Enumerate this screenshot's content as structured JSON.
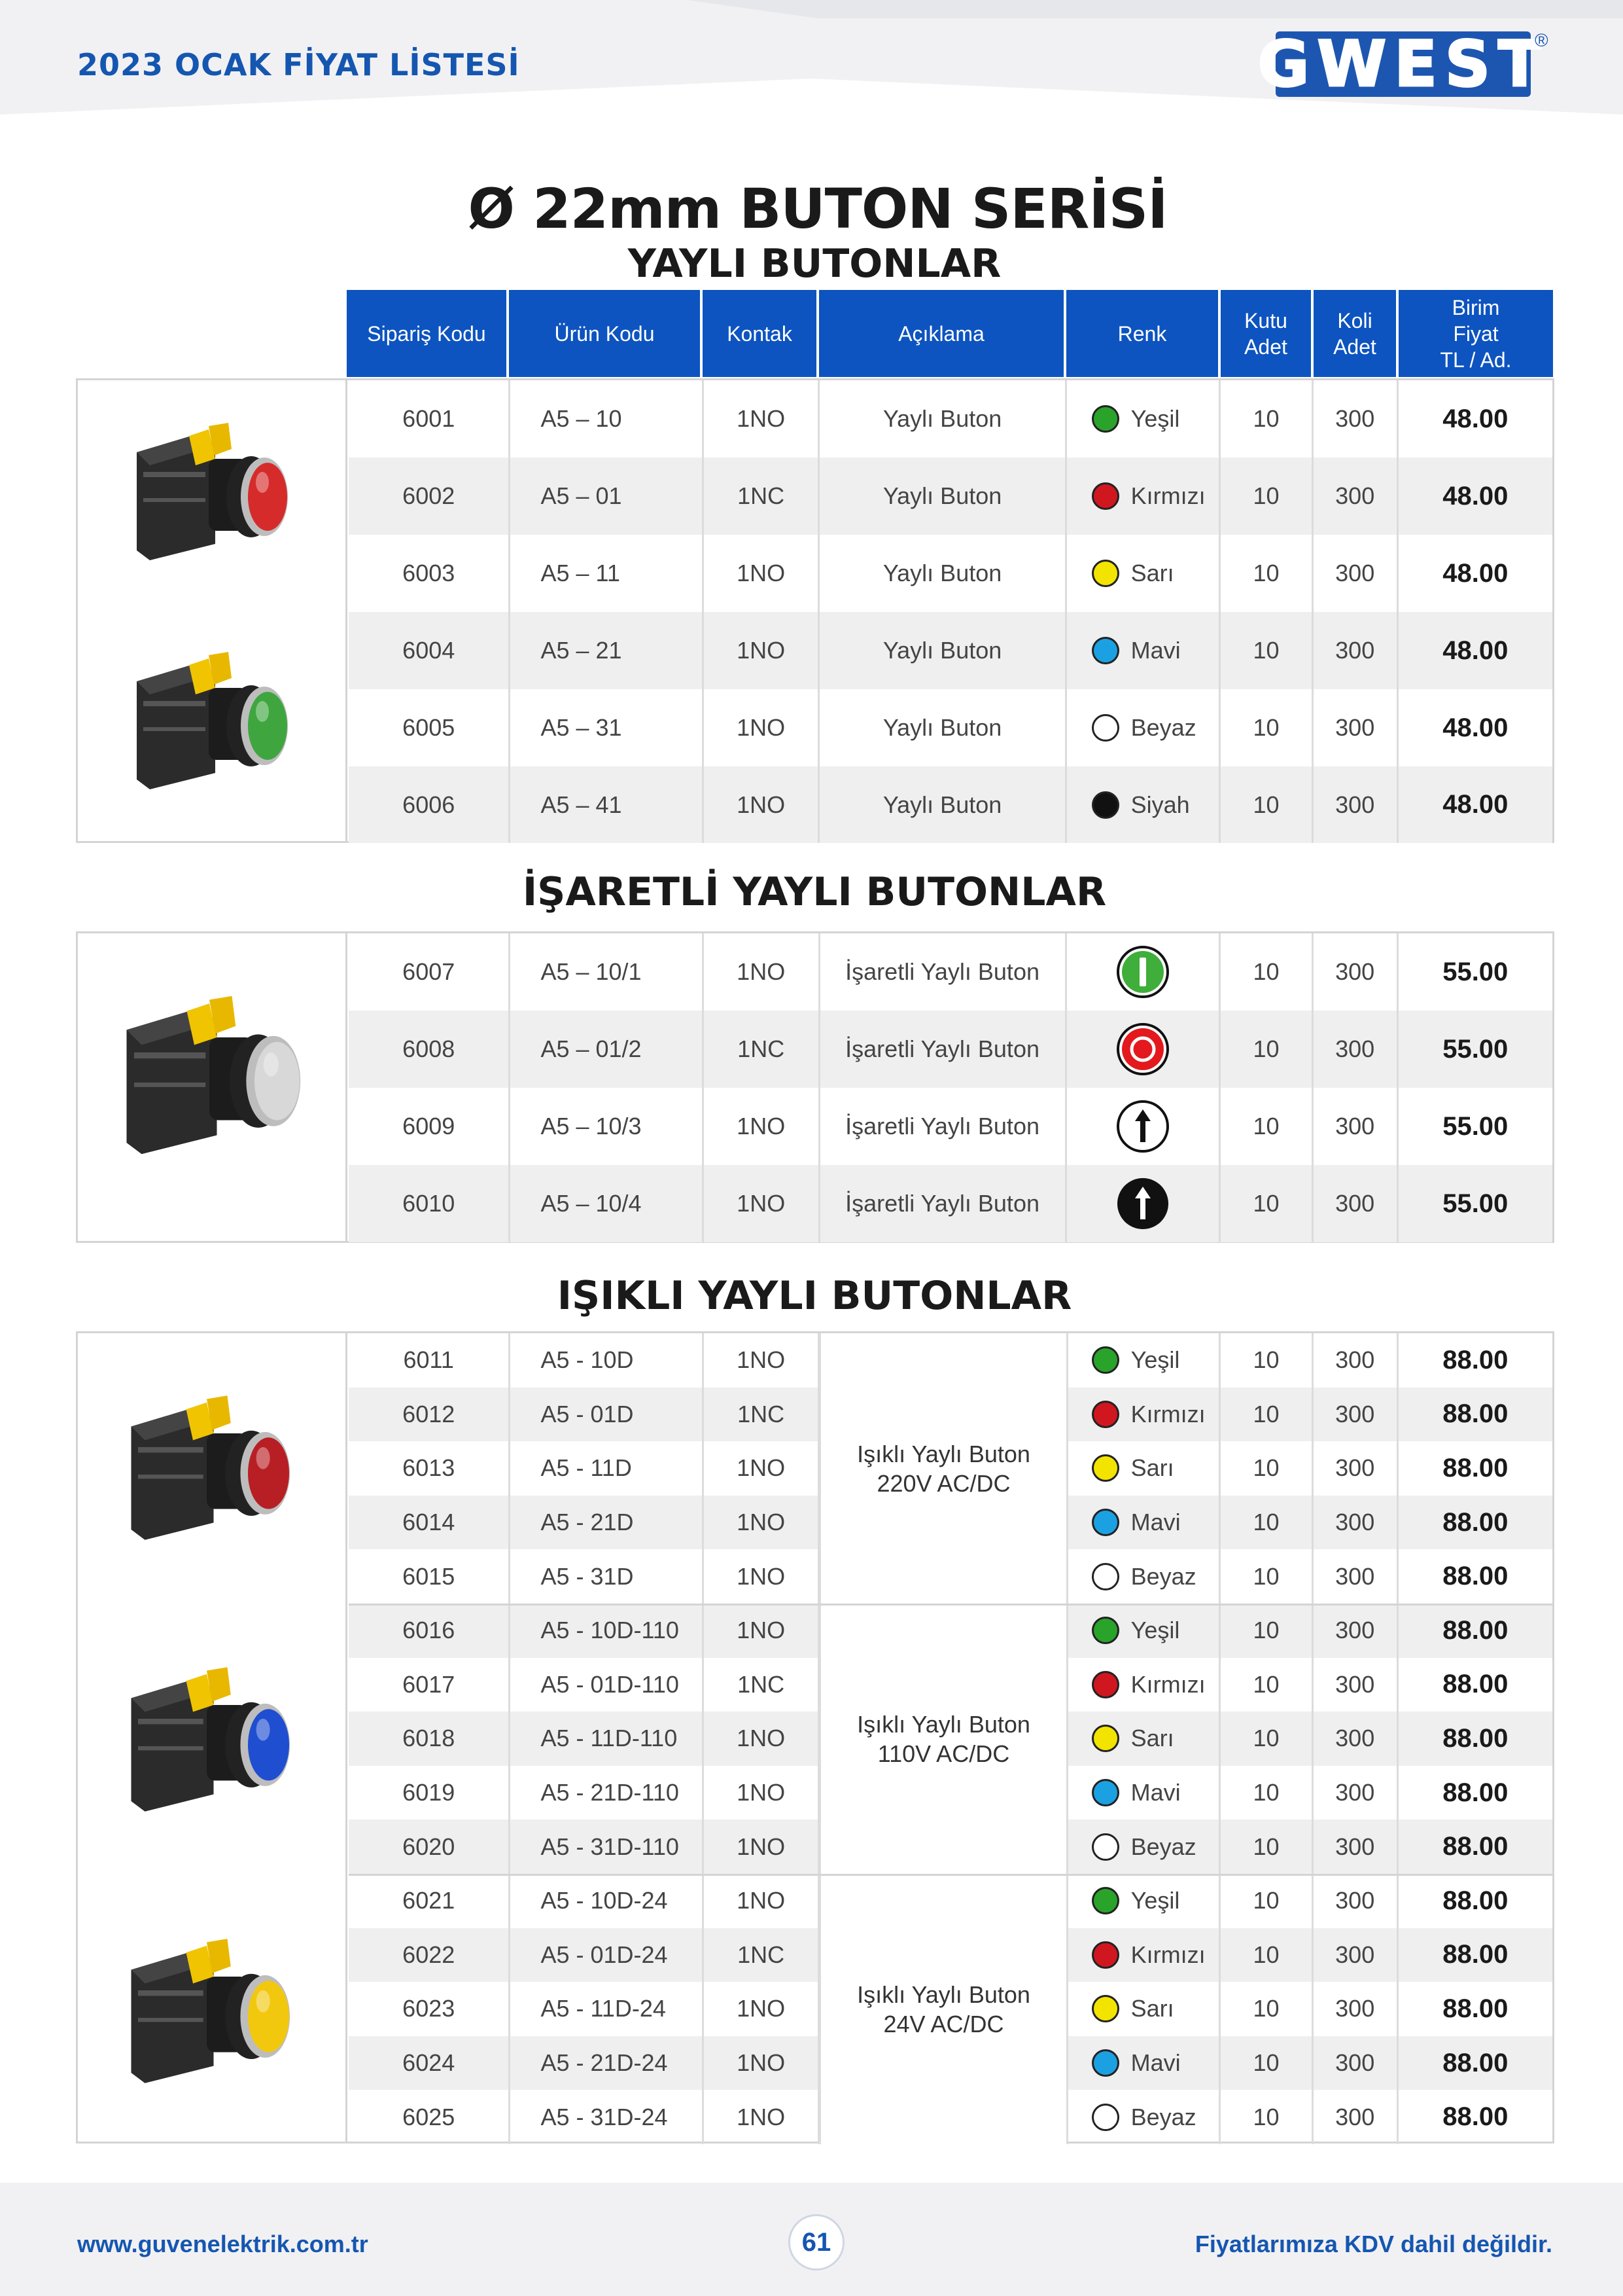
{
  "header": {
    "doc_title": "2023 OCAK FİYAT LİSTESİ",
    "logo_text": "GWEST",
    "logo_mark": "®"
  },
  "titles": {
    "main": "Ø 22mm BUTON SERİSİ",
    "section1": "YAYLI BUTONLAR",
    "section2": "İŞARETLİ YAYLI BUTONLAR",
    "section3": "IŞIKLI YAYLI BUTONLAR"
  },
  "columns": {
    "siparis": "Sipariş Kodu",
    "urun": "Ürün Kodu",
    "kontak": "Kontak",
    "aciklama": "Açıklama",
    "renk": "Renk",
    "kutu_1": "Kutu",
    "kutu_2": "Adet",
    "koli_1": "Koli",
    "koli_2": "Adet",
    "birim_1": "Birim",
    "birim_2": "Fiyat",
    "birim_3": "TL / Ad."
  },
  "colors": {
    "Yeşil": "#2aa32a",
    "Kırmızı": "#d0171f",
    "Sarı": "#f3e400",
    "Mavi": "#1ba1e2",
    "Beyaz": "#ffffff",
    "Siyah": "#111111",
    "brand_blue": "#0d54c0"
  },
  "section1_rows": [
    {
      "siparis": "6001",
      "urun": "A5 – 10",
      "kontak": "1NO",
      "aciklama": "Yaylı Buton",
      "renk": "Yeşil",
      "kutu": "10",
      "koli": "300",
      "fiyat": "48.00"
    },
    {
      "siparis": "6002",
      "urun": "A5 – 01",
      "kontak": "1NC",
      "aciklama": "Yaylı Buton",
      "renk": "Kırmızı",
      "kutu": "10",
      "koli": "300",
      "fiyat": "48.00"
    },
    {
      "siparis": "6003",
      "urun": "A5 – 11",
      "kontak": "1NO",
      "aciklama": "Yaylı Buton",
      "renk": "Sarı",
      "kutu": "10",
      "koli": "300",
      "fiyat": "48.00"
    },
    {
      "siparis": "6004",
      "urun": "A5 – 21",
      "kontak": "1NO",
      "aciklama": "Yaylı Buton",
      "renk": "Mavi",
      "kutu": "10",
      "koli": "300",
      "fiyat": "48.00"
    },
    {
      "siparis": "6005",
      "urun": "A5 – 31",
      "kontak": "1NO",
      "aciklama": "Yaylı Buton",
      "renk": "Beyaz",
      "kutu": "10",
      "koli": "300",
      "fiyat": "48.00"
    },
    {
      "siparis": "6006",
      "urun": "A5 – 41",
      "kontak": "1NO",
      "aciklama": "Yaylı Buton",
      "renk": "Siyah",
      "kutu": "10",
      "koli": "300",
      "fiyat": "48.00"
    }
  ],
  "section2_rows": [
    {
      "siparis": "6007",
      "urun": "A5 – 10/1",
      "kontak": "1NO",
      "aciklama": "İşaretli Yaylı Buton",
      "symbol": "green-I-icon",
      "kutu": "10",
      "koli": "300",
      "fiyat": "55.00"
    },
    {
      "siparis": "6008",
      "urun": "A5 – 01/2",
      "kontak": "1NC",
      "aciklama": "İşaretli Yaylı Buton",
      "symbol": "red-O-icon",
      "kutu": "10",
      "koli": "300",
      "fiyat": "55.00"
    },
    {
      "siparis": "6009",
      "urun": "A5 – 10/3",
      "kontak": "1NO",
      "aciklama": "İşaretli Yaylı Buton",
      "symbol": "white-arrow-up-icon",
      "kutu": "10",
      "koli": "300",
      "fiyat": "55.00"
    },
    {
      "siparis": "6010",
      "urun": "A5 – 10/4",
      "kontak": "1NO",
      "aciklama": "İşaretli Yaylı Buton",
      "symbol": "black-arrow-up-icon",
      "kutu": "10",
      "koli": "300",
      "fiyat": "55.00"
    }
  ],
  "section3_groups": [
    {
      "aciklama_1": "Işıklı Yaylı Buton",
      "aciklama_2": "220V AC/DC",
      "rows": [
        {
          "siparis": "6011",
          "urun": "A5 - 10D",
          "kontak": "1NO",
          "renk": "Yeşil",
          "kutu": "10",
          "koli": "300",
          "fiyat": "88.00"
        },
        {
          "siparis": "6012",
          "urun": "A5 - 01D",
          "kontak": "1NC",
          "renk": "Kırmızı",
          "kutu": "10",
          "koli": "300",
          "fiyat": "88.00"
        },
        {
          "siparis": "6013",
          "urun": "A5 - 11D",
          "kontak": "1NO",
          "renk": "Sarı",
          "kutu": "10",
          "koli": "300",
          "fiyat": "88.00"
        },
        {
          "siparis": "6014",
          "urun": "A5 - 21D",
          "kontak": "1NO",
          "renk": "Mavi",
          "kutu": "10",
          "koli": "300",
          "fiyat": "88.00"
        },
        {
          "siparis": "6015",
          "urun": "A5 - 31D",
          "kontak": "1NO",
          "renk": "Beyaz",
          "kutu": "10",
          "koli": "300",
          "fiyat": "88.00"
        }
      ]
    },
    {
      "aciklama_1": "Işıklı Yaylı Buton",
      "aciklama_2": "110V AC/DC",
      "rows": [
        {
          "siparis": "6016",
          "urun": "A5 - 10D-110",
          "kontak": "1NO",
          "renk": "Yeşil",
          "kutu": "10",
          "koli": "300",
          "fiyat": "88.00"
        },
        {
          "siparis": "6017",
          "urun": "A5 - 01D-110",
          "kontak": "1NC",
          "renk": "Kırmızı",
          "kutu": "10",
          "koli": "300",
          "fiyat": "88.00"
        },
        {
          "siparis": "6018",
          "urun": "A5 - 11D-110",
          "kontak": "1NO",
          "renk": "Sarı",
          "kutu": "10",
          "koli": "300",
          "fiyat": "88.00"
        },
        {
          "siparis": "6019",
          "urun": "A5 - 21D-110",
          "kontak": "1NO",
          "renk": "Mavi",
          "kutu": "10",
          "koli": "300",
          "fiyat": "88.00"
        },
        {
          "siparis": "6020",
          "urun": "A5 - 31D-110",
          "kontak": "1NO",
          "renk": "Beyaz",
          "kutu": "10",
          "koli": "300",
          "fiyat": "88.00"
        }
      ]
    },
    {
      "aciklama_1": "Işıklı Yaylı Buton",
      "aciklama_2": "24V AC/DC",
      "rows": [
        {
          "siparis": "6021",
          "urun": "A5 - 10D-24",
          "kontak": "1NO",
          "renk": "Yeşil",
          "kutu": "10",
          "koli": "300",
          "fiyat": "88.00"
        },
        {
          "siparis": "6022",
          "urun": "A5 - 01D-24",
          "kontak": "1NC",
          "renk": "Kırmızı",
          "kutu": "10",
          "koli": "300",
          "fiyat": "88.00"
        },
        {
          "siparis": "6023",
          "urun": "A5 - 11D-24",
          "kontak": "1NO",
          "renk": "Sarı",
          "kutu": "10",
          "koli": "300",
          "fiyat": "88.00"
        },
        {
          "siparis": "6024",
          "urun": "A5 - 21D-24",
          "kontak": "1NO",
          "renk": "Mavi",
          "kutu": "10",
          "koli": "300",
          "fiyat": "88.00"
        },
        {
          "siparis": "6025",
          "urun": "A5 - 31D-24",
          "kontak": "1NO",
          "renk": "Beyaz",
          "kutu": "10",
          "koli": "300",
          "fiyat": "88.00"
        }
      ]
    }
  ],
  "product_images": [
    {
      "name": "red-flush-button-image",
      "lens": "#d62b2b"
    },
    {
      "name": "green-flush-button-image",
      "lens": "#3fa63f"
    },
    {
      "name": "marked-white-button-image",
      "lens": "#d8d8d8"
    },
    {
      "name": "red-illuminated-button-image",
      "lens": "#b81f24"
    },
    {
      "name": "blue-illuminated-button-image",
      "lens": "#1f4ed0"
    },
    {
      "name": "yellow-illuminated-button-image",
      "lens": "#f2c80f"
    }
  ],
  "footer": {
    "url": "www.guvenelektrik.com.tr",
    "page": "61",
    "note": "Fiyatlarımıza KDV dahil değildir."
  }
}
